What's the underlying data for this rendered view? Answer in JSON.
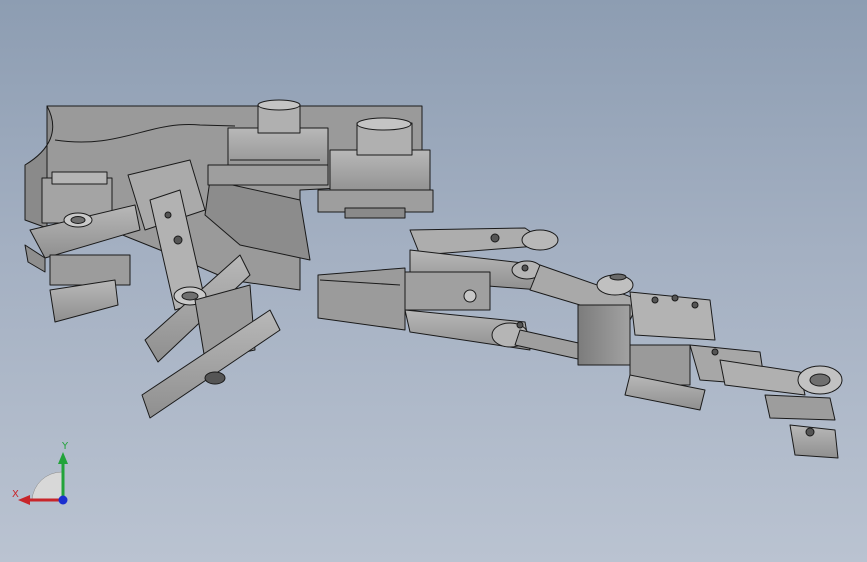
{
  "viewport": {
    "background_top": "#8d9db2",
    "background_bottom": "#bac3d1",
    "part_color": "#a6a6a6",
    "edge_color": "#1a1a1a"
  },
  "triad": {
    "x_label": "X",
    "y_label": "Y",
    "x_color": "#c8252a",
    "y_color": "#22a33a",
    "z_color": "#1b2fd0"
  },
  "model": {
    "name_icon": "robot-hand-assembly-icon"
  }
}
